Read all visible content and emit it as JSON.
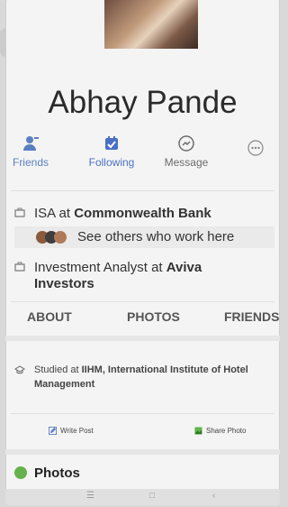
{
  "profile": {
    "name": "Abhay Pande"
  },
  "actions": {
    "friends": "Friends",
    "following": "Following",
    "message": "Message"
  },
  "work": {
    "line1_prefix": "ISA at ",
    "line1_org": "Commonwealth Bank",
    "others": "See others who work here",
    "line2_prefix": "Investment Analyst at ",
    "line2_org": "Aviva Investors"
  },
  "tabs": [
    "ABOUT",
    "PHOTOS",
    "FRIENDS"
  ],
  "education": {
    "prefix": "Studied at ",
    "school": "IIHM, International Institute of Hotel Management"
  },
  "buttons": {
    "write_post": "Write Post",
    "share_photo": "Share Photo"
  },
  "photos": {
    "title": "Photos"
  },
  "colors": {
    "accent_blue": "#4a70c6",
    "photo_green": "#64b24c"
  }
}
